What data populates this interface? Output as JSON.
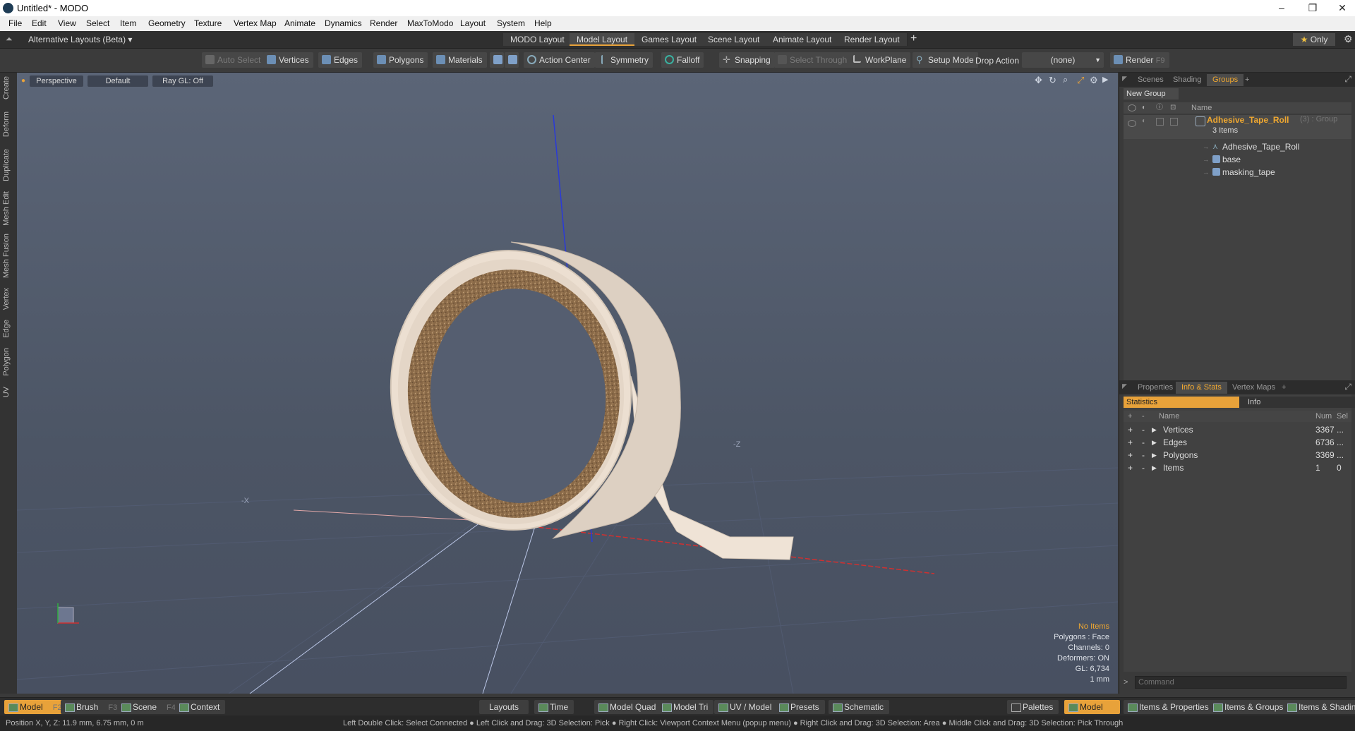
{
  "window": {
    "title": "Untitled* - MODO",
    "minimize": "–",
    "restore": "❐",
    "close": "✕"
  },
  "menu": [
    "File",
    "Edit",
    "View",
    "Select",
    "Item",
    "Geometry",
    "Texture",
    "Vertex Map",
    "Animate",
    "Dynamics",
    "Render",
    "MaxToModo",
    "Layout",
    "System",
    "Help"
  ],
  "layoutbar": {
    "alt_layouts": "Alternative Layouts (Beta)",
    "tabs": [
      "MODO Layout",
      "Model Layout",
      "Games Layout",
      "Scene Layout",
      "Animate Layout",
      "Render Layout"
    ],
    "active_tab": "Model Layout",
    "add": "+",
    "only": "Only"
  },
  "toolbar": {
    "auto_select": "Auto Select",
    "vertices": "Vertices",
    "edges": "Edges",
    "polygons": "Polygons",
    "materials": "Materials",
    "action_center": "Action Center",
    "symmetry": "Symmetry",
    "falloff": "Falloff",
    "snapping": "Snapping",
    "select_through": "Select Through",
    "workplane": "WorkPlane",
    "setup_mode": "Setup Mode",
    "drop_action_label": "Drop Action",
    "drop_action_value": "(none)",
    "render": "Render",
    "render_key": "F9"
  },
  "left_tabs": [
    "Create",
    "Deform",
    "Duplicate",
    "Mesh Edit",
    "Mesh Fusion",
    "Vertex",
    "Edge",
    "Polygon",
    "UV"
  ],
  "viewport": {
    "view_mode": "Perspective",
    "shading": "Default",
    "raygl": "Ray GL: Off",
    "axis_neg_x": "-X",
    "axis_neg_z": "-Z",
    "info": {
      "selection": "No Items",
      "polygons": "Polygons : Face",
      "channels": "Channels: 0",
      "deformers": "Deformers: ON",
      "gl": "GL: 6,734",
      "scale": "1 mm"
    },
    "colors": {
      "tape_outer": "#e9dccd",
      "tape_inner": "#a07a52",
      "axis_x": "#d03030",
      "axis_y": "#2a3ad8",
      "axis_z": "#30b040"
    }
  },
  "groups_panel": {
    "tabs": [
      "Scenes",
      "Shading",
      "Groups"
    ],
    "active_tab": "Groups",
    "add": "+",
    "new_group": "New Group",
    "column_name": "Name",
    "group": {
      "name": "Adhesive_Tape_Roll",
      "suffix": "(3) : Group",
      "count": "3 Items",
      "children": [
        "Adhesive_Tape_Roll",
        "base",
        "masking_tape"
      ]
    }
  },
  "stats_panel": {
    "tabs": [
      "Properties",
      "Info & Stats",
      "Vertex Maps"
    ],
    "active_tab": "Info & Stats",
    "add": "+",
    "subtabs": [
      "Statistics",
      "Info"
    ],
    "columns": {
      "plus": "+",
      "minus": "-",
      "name": "Name",
      "num": "Num",
      "sel": "Sel"
    },
    "rows": [
      {
        "name": "Vertices",
        "num": "3367",
        "sel": "..."
      },
      {
        "name": "Edges",
        "num": "6736",
        "sel": "..."
      },
      {
        "name": "Polygons",
        "num": "3369",
        "sel": "..."
      },
      {
        "name": "Items",
        "num": "1",
        "sel": "0"
      }
    ],
    "command_placeholder": "Command"
  },
  "bottombar": {
    "model": "Model",
    "model_key": "F2",
    "brush": "Brush",
    "brush_key": "F3",
    "scene": "Scene",
    "scene_key": "F4",
    "context": "Context",
    "layouts": "Layouts",
    "time": "Time",
    "model_quad": "Model Quad",
    "model_tri": "Model Tri",
    "uv_model": "UV / Model",
    "presets": "Presets",
    "schematic": "Schematic",
    "palettes": "Palettes",
    "model_right": "Model",
    "items_properties": "Items & Properties",
    "items_groups": "Items & Groups",
    "items_shading": "Items & Shading"
  },
  "statusbar": {
    "position": "Position X, Y, Z:   11.9 mm, 6.75 mm, 0 m",
    "hints": "Left Double Click: Select Connected ● Left Click and Drag: 3D Selection: Pick ● Right Click: Viewport Context Menu (popup menu) ● Right Click and Drag: 3D Selection: Area ● Middle Click and Drag: 3D Selection: Pick Through"
  }
}
